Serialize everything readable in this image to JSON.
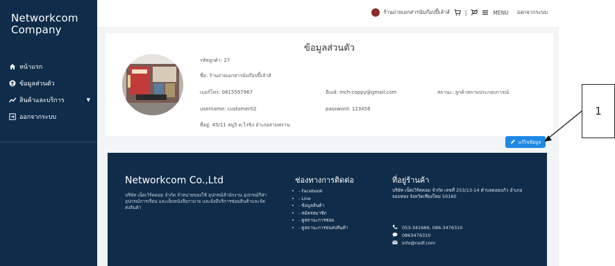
{
  "sidebar": {
    "brand": "Networkcom Company",
    "items": [
      {
        "icon": "home-icon",
        "label": "หน้าแรก"
      },
      {
        "icon": "user-circle-icon",
        "label": "ข้อมูลส่วนตัว"
      },
      {
        "icon": "trend-icon",
        "label": "สินค้าและบริการ"
      },
      {
        "icon": "logout-icon",
        "label": "ออกจากระบบ"
      }
    ]
  },
  "topbar": {
    "shop_name": "ร้านถ่ายเอกสารนับก๊อปปี้เล้าส์",
    "cart_icon": "cart-icon",
    "separator": "|",
    "menu_label": "MENU",
    "logout_label": "ออกจากระบบ"
  },
  "profile": {
    "title": "ข้อมูลส่วนตัว",
    "customer_id": "รหัสลูกค้า: 27",
    "name": "ชื่อ: ร้านถ่ายเอกสารนับก๊อปปี้เล้าส์",
    "phone": "เบอร์โทร: 0815597967",
    "email": "อีเมล์: mch-coppy@gmail.com",
    "status": "สถานะ: ลูกค้าสถานประกอบการณ์",
    "username": "username: customer02",
    "password": "password: 123456",
    "address": "ที่อยู่: 45/11 หมู่5 ต.ไร่ขิง อำเภอสามพราน",
    "edit_label": "แก้ไขข้อมูล"
  },
  "callout": {
    "number": "1"
  },
  "footer": {
    "brand": "Networkcom Co.,Ltd",
    "description": "บริษัท เน็ตเวิร์คคอม จำกัด จำหน่ายของใช้ อุปกรณ์สำนักงาน อุปกรณ์กีฬา อุปกรณ์การเรียน และเย็บหนังสือกามาย และยังมีบริการซ่อมสินค้าและจัดส่งสินค้า",
    "contact_title": "ช่องทางการติดต่อ",
    "links": [
      "- Facebook",
      "- Line",
      "- ข้อมูลสินค้า",
      "- สมัครสมาชิก",
      "- ดูสถานะการซ่อม",
      "- ดูสถานะการขนส่งสินค้า"
    ],
    "address_title": "ที่อยู่ร้านค้า",
    "address": "บริษัท เน็ตเวิร์คคอม จำกัด เลขที่ 253/13-14 ตำบลดอยแก้ว อำเภอจอมทอง จังหวัดเชียงใหม่ 50160",
    "phones": "053-341669, 086-3476310",
    "mobile": "0863476310",
    "email": "info@nsdf.com"
  },
  "colors": {
    "navy": "#0f2c4a",
    "accent": "#1e88e5"
  }
}
